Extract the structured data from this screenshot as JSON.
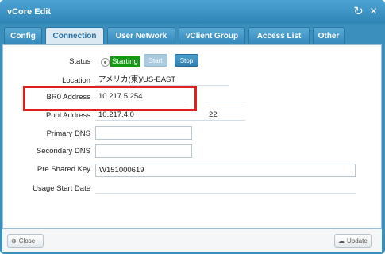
{
  "window": {
    "title": "vCore Edit"
  },
  "titlebar": {
    "refresh_icon": "↻",
    "close_icon": "✕"
  },
  "tabs": [
    {
      "label": "Config",
      "active": false
    },
    {
      "label": "Connection",
      "active": true
    },
    {
      "label": "User Network",
      "active": false
    },
    {
      "label": "vClient Group",
      "active": false
    },
    {
      "label": "Access List",
      "active": false
    },
    {
      "label": "Other",
      "active": false
    }
  ],
  "form": {
    "status_label": "Status",
    "status_value": "Starting",
    "start_button": "Start",
    "stop_button": "Stop",
    "location_label": "Location",
    "location_value": "アメリカ(東)/US-EAST",
    "br0_label": "BR0 Address",
    "br0_value": "10.217.5.254",
    "pool_label": "Pool Address",
    "pool_value": "10.217.4.0",
    "pool_prefix": "22",
    "primary_dns_label": "Primary DNS",
    "primary_dns_value": "",
    "secondary_dns_label": "Secondary DNS",
    "secondary_dns_value": "",
    "psk_label": "Pre Shared Key",
    "psk_value": "W151000619",
    "usage_label": "Usage Start Date",
    "usage_value": ""
  },
  "footer": {
    "close_label": "Close",
    "update_label": "Update"
  },
  "colors": {
    "accent": "#3a8fbd",
    "status_green": "#119911",
    "highlight_red": "#e0201f"
  }
}
